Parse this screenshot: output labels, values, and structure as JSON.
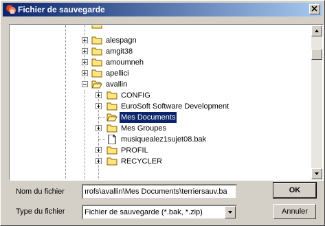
{
  "window": {
    "title": "Fichier de sauvegarde"
  },
  "tree": {
    "items": [
      {
        "label": "alespagn",
        "level": 1
      },
      {
        "label": "amgit38",
        "level": 1
      },
      {
        "label": "amoumneh",
        "level": 1
      },
      {
        "label": "apellici",
        "level": 1
      },
      {
        "label": "avallin",
        "level": 1
      },
      {
        "label": "CONFIG",
        "level": 2
      },
      {
        "label": "EuroSoft Software Development",
        "level": 2
      },
      {
        "label": "Mes Documents",
        "level": 2,
        "selected": true
      },
      {
        "label": "Mes Groupes",
        "level": 2
      },
      {
        "label": "musiquealez1sujet08.bak",
        "level": 2
      },
      {
        "label": "PROFIL",
        "level": 2
      },
      {
        "label": "RECYCLER",
        "level": 2
      }
    ]
  },
  "form": {
    "filename_label": "Nom du fichier",
    "filename_value": "ırofs\\avallin\\Mes Documents\\terriersauv.ba",
    "filetype_label": "Type du fichier",
    "filetype_value": "Fichier de sauvegarde (*.bak, *.zip)"
  },
  "buttons": {
    "ok": "OK",
    "cancel": "Annuler"
  },
  "colors": {
    "title_start": "#0a246a",
    "title_end": "#a6caf0",
    "selection": "#0a246a"
  }
}
